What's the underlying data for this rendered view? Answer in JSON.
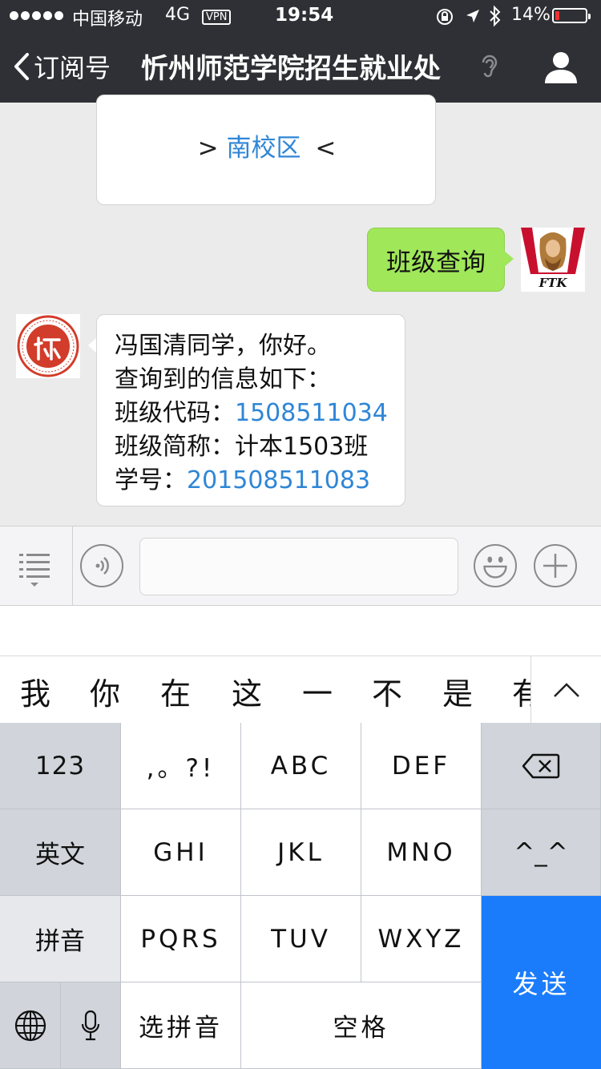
{
  "status_bar": {
    "carrier": "中国移动",
    "network": "4G",
    "vpn": "VPN",
    "time": "19:54",
    "battery": "14%",
    "battery_level": 0.14
  },
  "nav": {
    "back_label": "订阅号",
    "title": "忻州师范学院招生就业处"
  },
  "messages": {
    "campus": {
      "prefix": ">",
      "link": "南校区",
      "suffix": "<"
    },
    "query": "班级查询",
    "right_avatar_text": "FTK",
    "info": {
      "greeting": "冯国清同学，你好。",
      "intro": "查询到的信息如下：",
      "class_code_label": "班级代码：",
      "class_code": "1508511034",
      "class_name_label": "班级简称：",
      "class_name": "计本1503班",
      "student_no_label": "学号：",
      "student_no": "201508511083"
    }
  },
  "candidates": [
    "我",
    "你",
    "在",
    "这",
    "一",
    "不",
    "是",
    "有"
  ],
  "keyboard": {
    "row1": [
      "123",
      ",。?!",
      "ABC",
      "DEF"
    ],
    "row2": [
      "英文",
      "GHI",
      "JKL",
      "MNO",
      "^_^"
    ],
    "row3": [
      "拼音",
      "PQRS",
      "TUV",
      "WXYZ"
    ],
    "row4": [
      "选拼音",
      "空格"
    ],
    "send": "发送"
  },
  "colors": {
    "nav_bg": "#2f3035",
    "link": "#2f86d6",
    "bubble_green": "#a0e75a",
    "send_key": "#1a7cfb"
  }
}
